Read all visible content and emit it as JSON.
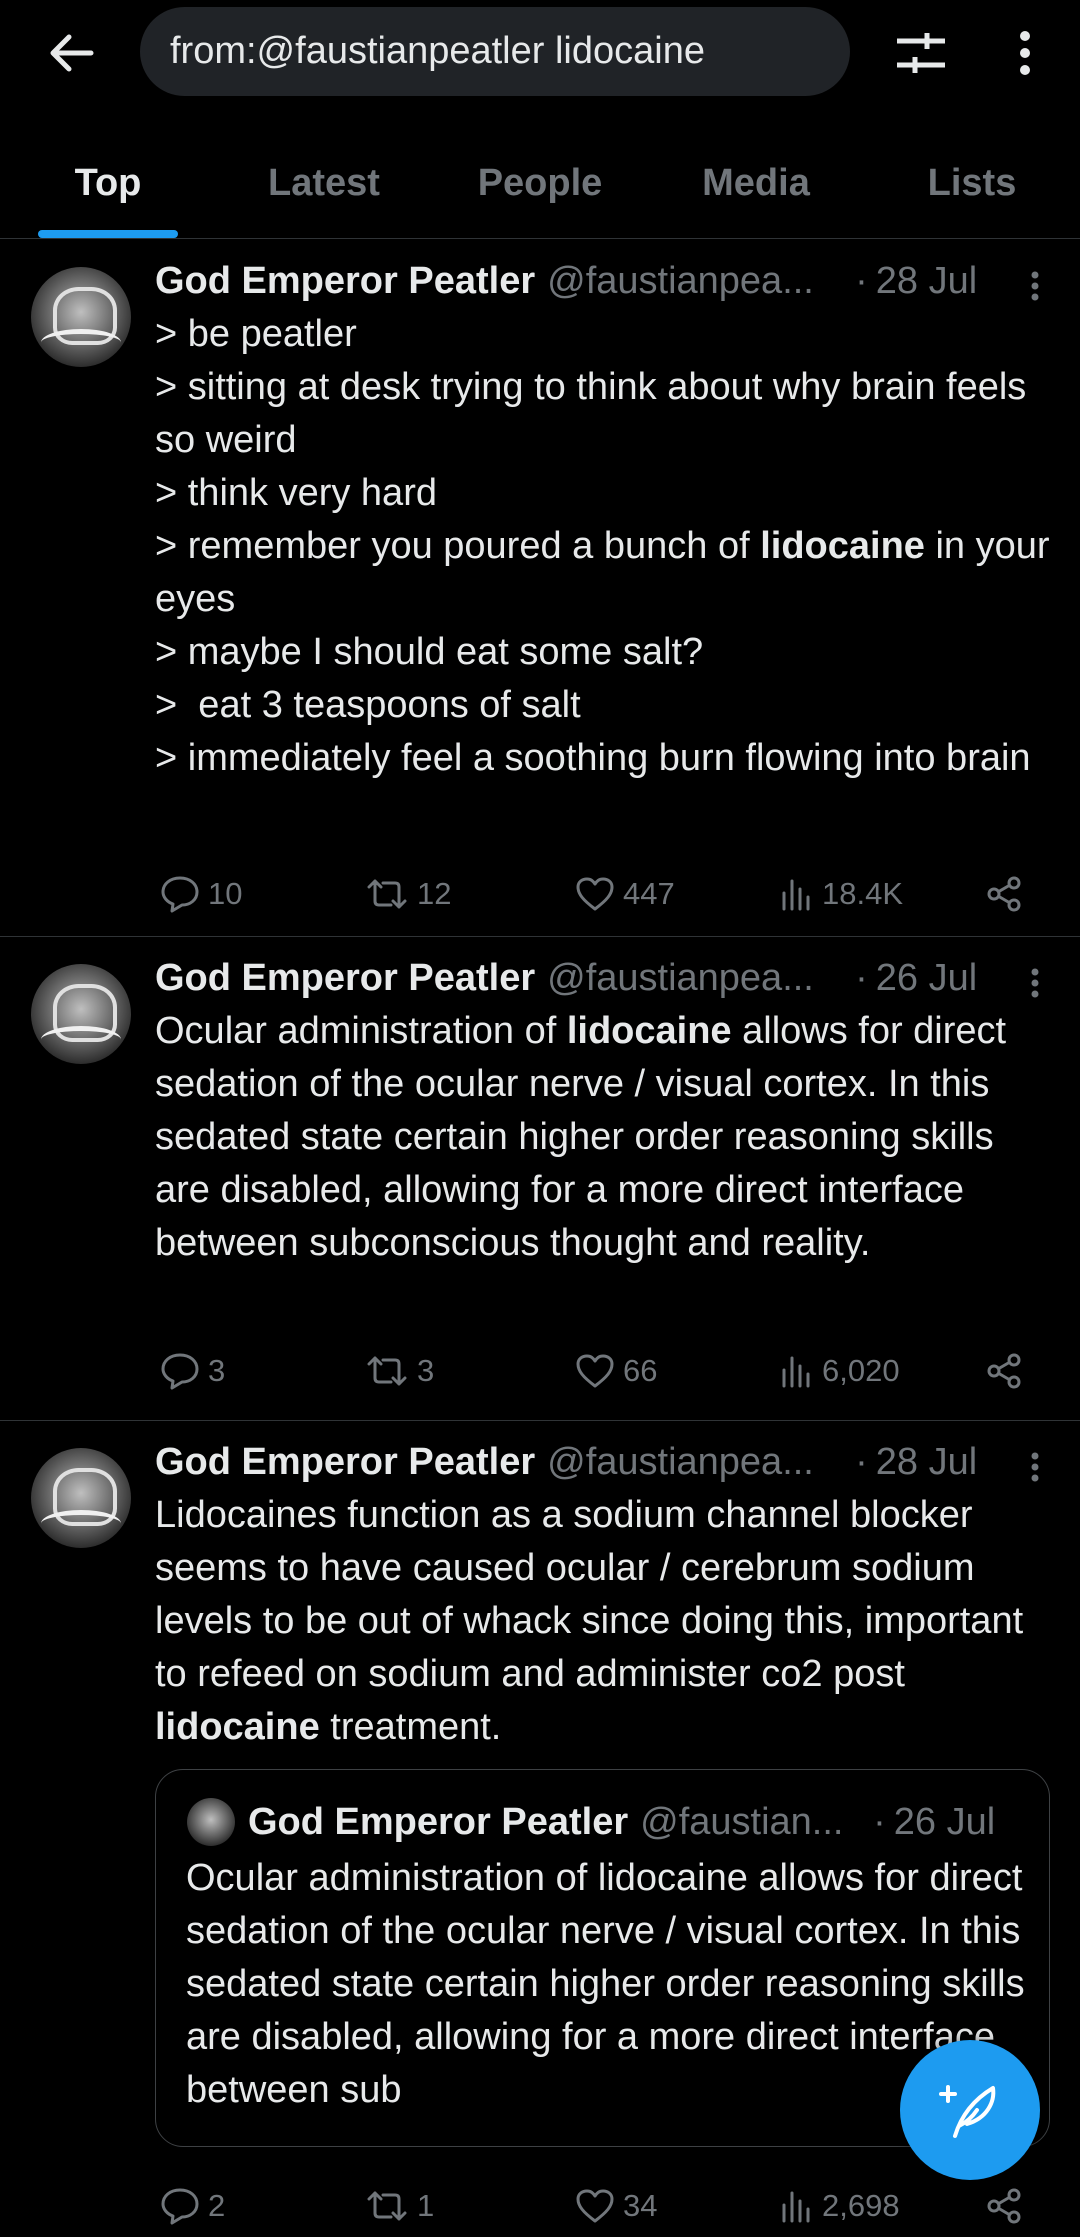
{
  "search": {
    "query": "from:@faustianpeatler lidocaine"
  },
  "tabs": [
    {
      "label": "Top"
    },
    {
      "label": "Latest"
    },
    {
      "label": "People"
    },
    {
      "label": "Media"
    },
    {
      "label": "Lists"
    }
  ],
  "colors": {
    "accent": "#1d9bf0",
    "background": "#000000",
    "muted": "#71767b",
    "text": "#e7e9ea"
  },
  "tweets": [
    {
      "name": "God Emperor Peatler",
      "handle": "@faustianpea...",
      "date": "28 Jul",
      "text_parts": [
        "> be peatler\n> sitting at desk trying to think about why brain feels so weird\n> think very hard\n> remember you poured a bunch of ",
        "lidocaine",
        " in your eyes\n> maybe I should eat some salt?\n>  eat 3 teaspoons of salt\n> immediately feel a soothing burn flowing into brain"
      ],
      "replies": "10",
      "reposts": "12",
      "likes": "447",
      "views": "18.4K"
    },
    {
      "name": "God Emperor Peatler",
      "handle": "@faustianpea...",
      "date": "26 Jul",
      "text_parts": [
        "Ocular administration of ",
        "lidocaine",
        " allows for direct sedation of the ocular nerve / visual cortex. In this sedated state certain higher order reasoning skills are disabled, allowing for a more direct interface between subconscious thought and reality."
      ],
      "replies": "3",
      "reposts": "3",
      "likes": "66",
      "views": "6,020"
    },
    {
      "name": "God Emperor Peatler",
      "handle": "@faustianpea...",
      "date": "28 Jul",
      "text_parts": [
        "Lidocaines function as a sodium channel blocker seems to have caused ocular / cerebrum sodium levels to be out of whack since doing this, important to refeed on sodium and administer co2 post ",
        "lidocaine",
        " treatment."
      ],
      "quote": {
        "name": "God Emperor Peatler",
        "handle": "@faustian...",
        "date": "26 Jul",
        "text": "Ocular administration of lidocaine allows for direct sedation of the ocular nerve / visual cortex. In this sedated state certain higher order reasoning skills are disabled, allowing for a more direct interface between sub"
      },
      "replies": "2",
      "reposts": "1",
      "likes": "34",
      "views": "2,698"
    }
  ],
  "icons": {
    "back": "arrow-left-icon",
    "filter": "sliders-icon",
    "more": "more-vertical-icon",
    "reply": "reply-icon",
    "repost": "repost-icon",
    "like": "heart-icon",
    "views": "views-icon",
    "share": "share-icon",
    "compose": "compose-icon"
  }
}
